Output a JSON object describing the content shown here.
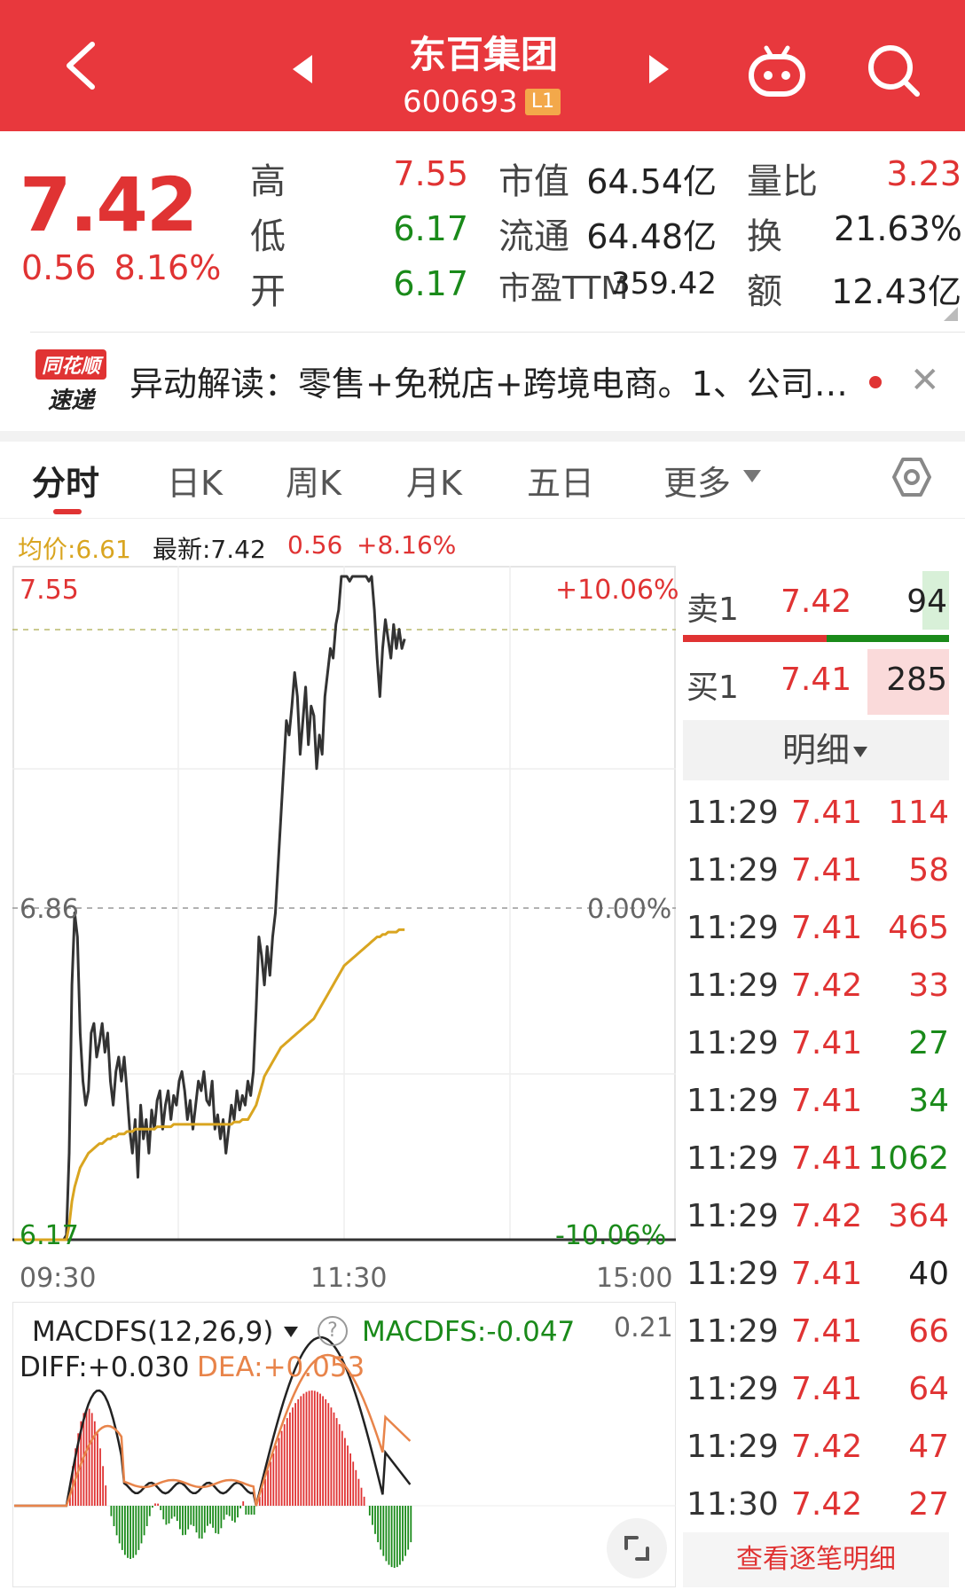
{
  "header": {
    "title": "东百集团",
    "code": "600693",
    "level_badge": "L1"
  },
  "quote": {
    "price": "7.42",
    "change": "0.56",
    "change_pct": "8.16%",
    "stats": [
      {
        "label": "高",
        "value": "7.55",
        "color": "red"
      },
      {
        "label": "低",
        "value": "6.17",
        "color": "green"
      },
      {
        "label": "开",
        "value": "6.17",
        "color": "green"
      },
      {
        "label": "市值",
        "value": "64.54亿",
        "color": "dark"
      },
      {
        "label": "流通",
        "value": "64.48亿",
        "color": "dark"
      },
      {
        "label": "市盈TTM",
        "value": "359.42",
        "color": "dark"
      },
      {
        "label": "量比",
        "value": "3.23",
        "color": "red"
      },
      {
        "label": "换",
        "value": "21.63%",
        "color": "dark"
      },
      {
        "label": "额",
        "value": "12.43亿",
        "color": "dark"
      }
    ]
  },
  "news": {
    "logo_line1": "同花顺",
    "logo_line2": "速递",
    "text": "异动解读：零售+免税店+跨境电商。1、公司…"
  },
  "tabs": [
    "分时",
    "日K",
    "周K",
    "月K",
    "五日",
    "更多"
  ],
  "info_line": {
    "avg": "均价:6.61",
    "latest": "最新:7.42",
    "change": "0.56",
    "pct": "+8.16%"
  },
  "chart_data": {
    "type": "line",
    "y_left_labels": {
      "top": "7.55",
      "mid": "6.86",
      "bottom": "6.17"
    },
    "y_right_labels": {
      "top": "+10.06%",
      "mid": "0.00%",
      "bottom": "-10.06%"
    },
    "x_labels": [
      "09:30",
      "11:30",
      "15:00"
    ],
    "ylim": [
      6.17,
      7.55
    ],
    "series": [
      {
        "name": "price",
        "color": "#333333",
        "values": [
          6.17,
          6.17,
          6.17,
          6.17,
          6.17,
          6.17,
          6.17,
          6.17,
          6.17,
          6.17,
          6.17,
          6.17,
          6.17,
          6.17,
          6.17,
          6.17,
          6.17,
          6.17,
          6.17,
          6.18,
          6.35,
          6.7,
          6.85,
          6.8,
          6.6,
          6.5,
          6.45,
          6.48,
          6.6,
          6.62,
          6.55,
          6.58,
          6.62,
          6.56,
          6.6,
          6.5,
          6.45,
          6.52,
          6.55,
          6.5,
          6.55,
          6.48,
          6.4,
          6.35,
          6.42,
          6.3,
          6.45,
          6.38,
          6.42,
          6.35,
          6.44,
          6.4,
          6.46,
          6.48,
          6.4,
          6.45,
          6.48,
          6.42,
          6.47,
          6.45,
          6.5,
          6.52,
          6.48,
          6.42,
          6.46,
          6.4,
          6.45,
          6.5,
          6.48,
          6.52,
          6.46,
          6.45,
          6.5,
          6.4,
          6.43,
          6.38,
          6.42,
          6.35,
          6.4,
          6.45,
          6.42,
          6.48,
          6.44,
          6.47,
          6.45,
          6.5,
          6.47,
          6.52,
          6.65,
          6.8,
          6.76,
          6.7,
          6.78,
          6.72,
          6.8,
          6.85,
          6.95,
          7.05,
          7.15,
          7.25,
          7.22,
          7.28,
          7.35,
          7.3,
          7.18,
          7.25,
          7.32,
          7.2,
          7.28,
          7.26,
          7.15,
          7.22,
          7.18,
          7.3,
          7.35,
          7.4,
          7.38,
          7.45,
          7.48,
          7.55,
          7.55,
          7.55,
          7.54,
          7.55,
          7.55,
          7.55,
          7.55,
          7.55,
          7.55,
          7.54,
          7.55,
          7.48,
          7.38,
          7.3,
          7.4,
          7.46,
          7.42,
          7.38,
          7.45,
          7.4,
          7.44,
          7.4,
          7.42
        ]
      },
      {
        "name": "avg",
        "color": "#d9a520",
        "values": [
          6.17,
          6.17,
          6.17,
          6.17,
          6.17,
          6.17,
          6.17,
          6.17,
          6.17,
          6.17,
          6.17,
          6.17,
          6.17,
          6.17,
          6.17,
          6.17,
          6.17,
          6.17,
          6.17,
          6.17,
          6.2,
          6.25,
          6.28,
          6.3,
          6.32,
          6.33,
          6.34,
          6.35,
          6.355,
          6.36,
          6.365,
          6.37,
          6.37,
          6.375,
          6.38,
          6.38,
          6.385,
          6.385,
          6.39,
          6.39,
          6.39,
          6.395,
          6.395,
          6.395,
          6.4,
          6.4,
          6.4,
          6.4,
          6.4,
          6.4,
          6.4,
          6.4,
          6.405,
          6.405,
          6.405,
          6.405,
          6.405,
          6.405,
          6.41,
          6.41,
          6.41,
          6.41,
          6.41,
          6.41,
          6.41,
          6.41,
          6.41,
          6.41,
          6.41,
          6.41,
          6.41,
          6.41,
          6.41,
          6.41,
          6.41,
          6.41,
          6.41,
          6.41,
          6.41,
          6.41,
          6.415,
          6.415,
          6.415,
          6.42,
          6.42,
          6.42,
          6.43,
          6.44,
          6.45,
          6.47,
          6.49,
          6.51,
          6.52,
          6.53,
          6.54,
          6.55,
          6.56,
          6.57,
          6.575,
          6.58,
          6.585,
          6.59,
          6.595,
          6.6,
          6.605,
          6.61,
          6.615,
          6.62,
          6.625,
          6.63,
          6.64,
          6.65,
          6.66,
          6.67,
          6.68,
          6.69,
          6.7,
          6.71,
          6.72,
          6.73,
          6.74,
          6.745,
          6.75,
          6.755,
          6.76,
          6.765,
          6.77,
          6.775,
          6.78,
          6.785,
          6.79,
          6.795,
          6.8,
          6.8,
          6.805,
          6.805,
          6.81,
          6.81,
          6.81,
          6.81,
          6.815,
          6.815,
          6.815
        ]
      }
    ]
  },
  "macd": {
    "title": "MACDFS(12,26,9)",
    "macdfs": "MACDFS:-0.047",
    "scale_top": "0.21",
    "diff": "DIFF:+0.030",
    "dea": "DEA:+0.053"
  },
  "orderbook": {
    "sell": {
      "label": "卖1",
      "price": "7.42",
      "volume": "94"
    },
    "buy": {
      "label": "买1",
      "price": "7.41",
      "volume": "285"
    },
    "detail_label": "明细",
    "view_all": "查看逐笔明细",
    "ticks": [
      {
        "time": "11:29",
        "price": "7.41",
        "vol": "114",
        "side": "red"
      },
      {
        "time": "11:29",
        "price": "7.41",
        "vol": "58",
        "side": "red"
      },
      {
        "time": "11:29",
        "price": "7.41",
        "vol": "465",
        "side": "red"
      },
      {
        "time": "11:29",
        "price": "7.42",
        "vol": "33",
        "side": "red"
      },
      {
        "time": "11:29",
        "price": "7.41",
        "vol": "27",
        "side": "green"
      },
      {
        "time": "11:29",
        "price": "7.41",
        "vol": "34",
        "side": "green"
      },
      {
        "time": "11:29",
        "price": "7.41",
        "vol": "1062",
        "side": "green"
      },
      {
        "time": "11:29",
        "price": "7.42",
        "vol": "364",
        "side": "red"
      },
      {
        "time": "11:29",
        "price": "7.41",
        "vol": "40",
        "side": "dark"
      },
      {
        "time": "11:29",
        "price": "7.41",
        "vol": "66",
        "side": "red"
      },
      {
        "time": "11:29",
        "price": "7.41",
        "vol": "64",
        "side": "red"
      },
      {
        "time": "11:29",
        "price": "7.42",
        "vol": "47",
        "side": "red"
      },
      {
        "time": "11:30",
        "price": "7.42",
        "vol": "27",
        "side": "red"
      }
    ]
  }
}
